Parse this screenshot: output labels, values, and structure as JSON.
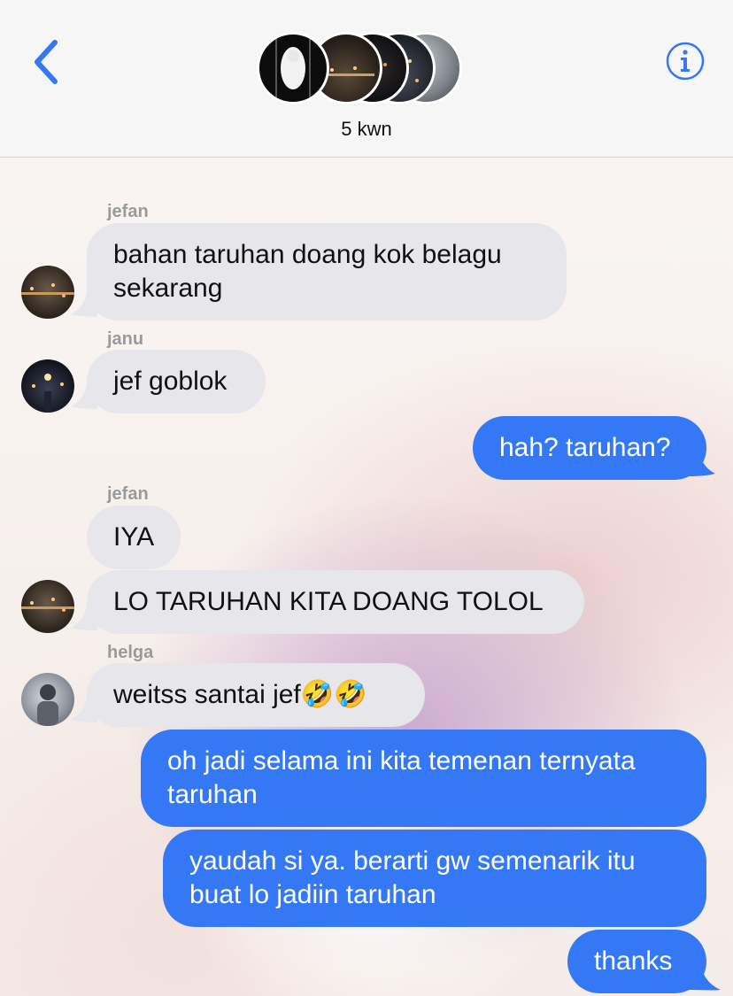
{
  "header": {
    "member_count": "5 kwn",
    "back_icon": "chevron-left-icon",
    "info_icon": "info-icon",
    "accent": "#3478f6"
  },
  "messages": [
    {
      "sender": "jefan",
      "text": "bahan taruhan doang kok belagu\nsekarang",
      "direction": "in"
    },
    {
      "sender": "janu",
      "text": "jef goblok",
      "direction": "in"
    },
    {
      "text": "hah? taruhan?",
      "direction": "out"
    },
    {
      "sender": "jefan",
      "text": "IYA",
      "direction": "in"
    },
    {
      "text": "LO TARUHAN KITA DOANG TOLOL",
      "direction": "in"
    },
    {
      "sender": "helga",
      "text": "weitss santai jef🤣🤣",
      "direction": "in"
    },
    {
      "text": "oh jadi selama ini kita temenan ternyata\ntaruhan",
      "direction": "out"
    },
    {
      "text": "yaudah si ya. berarti gw semenarik itu\nbuat lo jadiin taruhan",
      "direction": "out"
    },
    {
      "text": "thanks",
      "direction": "out"
    }
  ],
  "colors": {
    "incoming_bubble": "#e6e6eb",
    "outgoing_bubble": "#3478f6"
  }
}
